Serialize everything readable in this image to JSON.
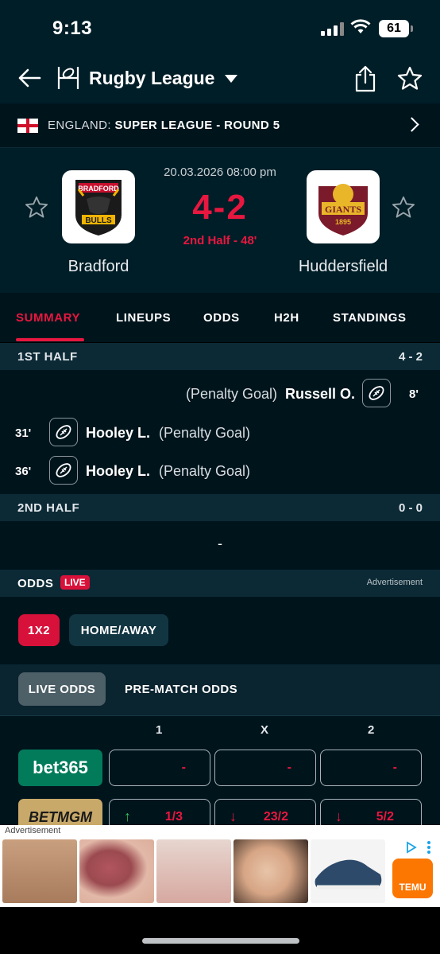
{
  "status_bar": {
    "time": "9:13",
    "battery": "61"
  },
  "header": {
    "sport": "Rugby League"
  },
  "league": {
    "country": "ENGLAND:",
    "competition": "SUPER LEAGUE - ROUND 5"
  },
  "match": {
    "datetime": "20.03.2026 08:00 pm",
    "score": "4-2",
    "status": "2nd Half - 48'",
    "home": {
      "name": "Bradford",
      "logo_text": "BULLS",
      "logo_top": "BRADFORD"
    },
    "away": {
      "name": "Huddersfield",
      "logo_text": "GIANTS",
      "logo_year": "1895"
    }
  },
  "tabs": [
    "SUMMARY",
    "LINEUPS",
    "ODDS",
    "H2H",
    "STANDINGS"
  ],
  "first_half": {
    "label": "1ST HALF",
    "score": "4 - 2",
    "events": [
      {
        "side": "away",
        "minute": "8'",
        "player": "Russell O.",
        "type": "(Penalty Goal)"
      },
      {
        "side": "home",
        "minute": "31'",
        "player": "Hooley L.",
        "type": "(Penalty Goal)"
      },
      {
        "side": "home",
        "minute": "36'",
        "player": "Hooley L.",
        "type": "(Penalty Goal)"
      }
    ]
  },
  "second_half": {
    "label": "2ND HALF",
    "score": "0 - 0",
    "empty": "-"
  },
  "odds": {
    "title": "ODDS",
    "live_badge": "LIVE",
    "advertisement": "Advertisement",
    "markets": [
      "1X2",
      "HOME/AWAY"
    ],
    "modes": [
      "LIVE ODDS",
      "PRE-MATCH ODDS"
    ],
    "columns": [
      "1",
      "X",
      "2"
    ],
    "bookmakers": [
      {
        "name": "bet365",
        "values": [
          "-",
          "-",
          "-"
        ],
        "arrows": [
          "",
          "",
          ""
        ]
      },
      {
        "name": "BETMGM",
        "values": [
          "1/3",
          "23/2",
          "5/2"
        ],
        "arrows": [
          "up",
          "down",
          "down"
        ]
      }
    ]
  },
  "ad": {
    "label": "Advertisement",
    "brand": "TEMU"
  },
  "colors": {
    "accent": "#e8173f",
    "bg": "#001e28",
    "section": "#0c2a36"
  }
}
